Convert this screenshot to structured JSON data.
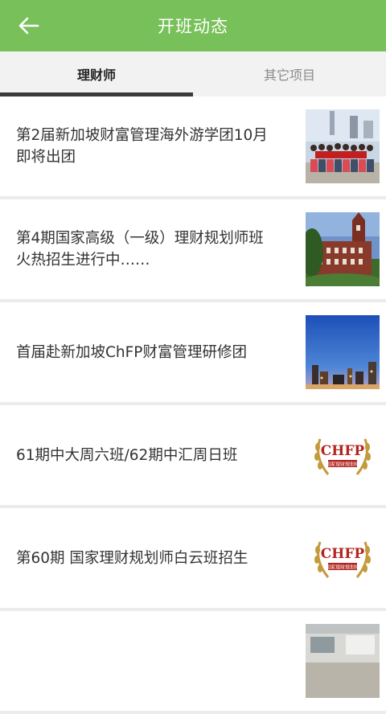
{
  "header": {
    "title": "开班动态"
  },
  "tabs": [
    {
      "label": "理财师",
      "active": true
    },
    {
      "label": "其它项目",
      "active": false
    }
  ],
  "items": [
    {
      "title": "第2届新加坡财富管理海外游学团10月即将出团",
      "thumb": "group-photo"
    },
    {
      "title": "第4期国家高级（一级）理财规划师班火热招生进行中……",
      "thumb": "campus-building-photo"
    },
    {
      "title": "首届赴新加坡ChFP财富管理研修团",
      "thumb": "city-skyline-photo"
    },
    {
      "title": "61期中大周六班/62期中汇周日班",
      "thumb": "chfp-logo",
      "logo_text": "CHFP",
      "logo_subtext": "国家理财规划师"
    },
    {
      "title": "第60期 国家理财规划师白云班招生",
      "thumb": "chfp-logo",
      "logo_text": "CHFP",
      "logo_subtext": "国家理财规划师"
    },
    {
      "title": "",
      "thumb": "classroom-photo"
    }
  ],
  "colors": {
    "accent": "#78c05a",
    "tab_indicator": "#3b3b3b",
    "logo_red": "#b3241f",
    "logo_gold": "#c49a3a"
  }
}
